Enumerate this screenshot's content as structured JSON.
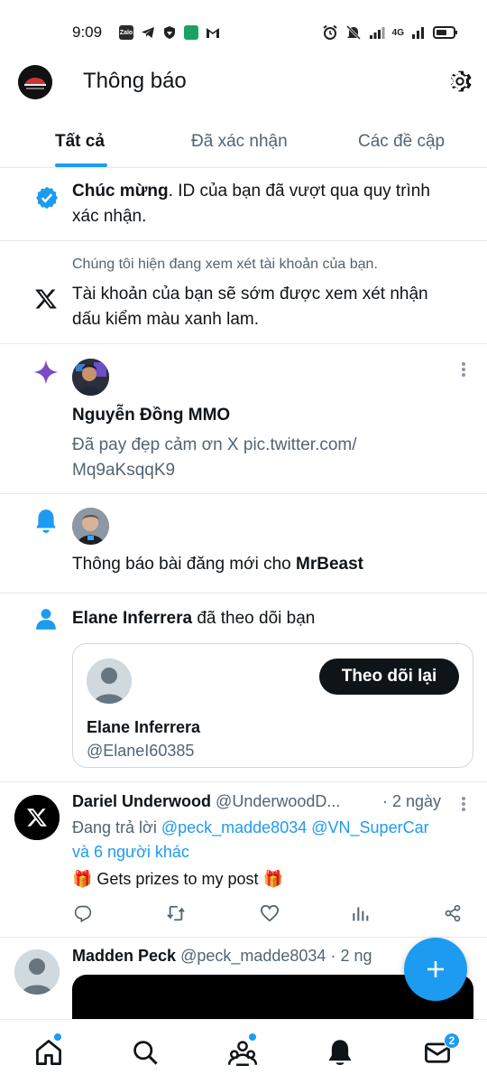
{
  "status_bar": {
    "time": "9:09",
    "apps": [
      "Zalo",
      "telegram-icon",
      "vpn-icon",
      "messages-icon",
      "gmail-icon"
    ],
    "network": "4G"
  },
  "header": {
    "title": "Thông báo"
  },
  "tabs": [
    {
      "label": "Tất cả",
      "active": true
    },
    {
      "label": "Đã xác nhận",
      "active": false
    },
    {
      "label": "Các đề cập",
      "active": false
    }
  ],
  "notifications": {
    "verify": {
      "bold": "Chúc mừng",
      "text_line1": ". ID của bạn đã vượt qua quy trình",
      "text_line2": "xác nhận."
    },
    "review": {
      "subtitle": "Chúng tôi hiện đang xem xét tài khoản của bạn.",
      "line1": "Tài khoản của bạn sẽ sớm được xem xét nhận",
      "line2": "dấu kiểm màu xanh lam."
    },
    "recommended": {
      "name": "Nguyễn Đồng MMO",
      "line1": "Đã pay đẹp cảm ơn X pic.twitter.com/",
      "line2": "Mq9aKsqqK9"
    },
    "new_post": {
      "text": "Thông báo bài đăng mới cho ",
      "account": "MrBeast"
    },
    "follow": {
      "name": "Elane Inferrera",
      "action": " đã theo dõi bạn",
      "card_name": "Elane Inferrera",
      "card_handle": "@ElaneI60385",
      "follow_back_label": "Theo dõi lại"
    },
    "reply_post": {
      "name": "Dariel Underwood",
      "handle": "@UnderwoodD...",
      "time": "· 2 ngày",
      "reply_prefix": "Đang trả lời ",
      "mention1": "@peck_madde8034",
      "mention2": "@VN_SuperCar",
      "others": "và 6 người khác",
      "body": "🎁 Gets prizes to my post 🎁"
    },
    "next_post": {
      "name": "Madden Peck",
      "handle": "@peck_madde8034",
      "time": "· 2 ng"
    }
  },
  "bottom_nav": {
    "messages_badge": "2"
  },
  "colors": {
    "accent": "#1d9bf0",
    "text": "#0f1419",
    "muted": "#536471",
    "purple": "#794bc4"
  }
}
